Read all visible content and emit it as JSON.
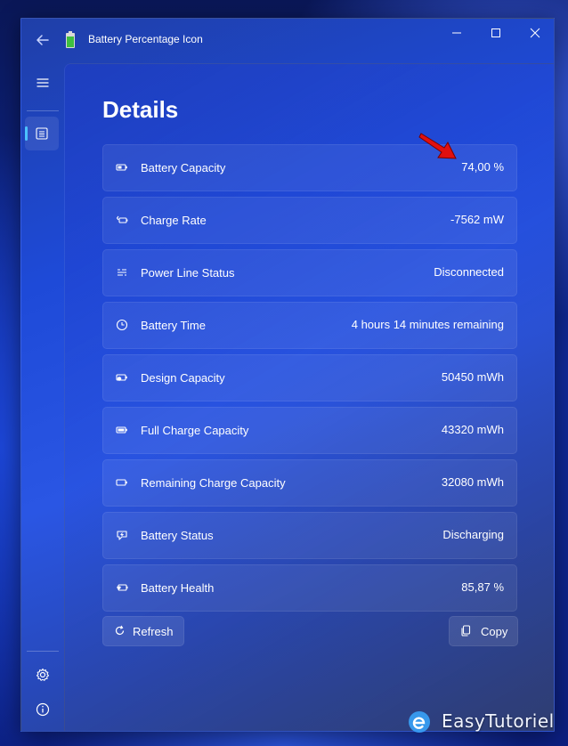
{
  "window": {
    "title": "Battery Percentage Icon"
  },
  "page": {
    "title": "Details"
  },
  "rows": [
    {
      "label": "Battery Capacity",
      "value": "74,00 %",
      "icon": "battery-icon"
    },
    {
      "label": "Charge Rate",
      "value": "-7562 mW",
      "icon": "charge-rate-icon"
    },
    {
      "label": "Power Line Status",
      "value": "Disconnected",
      "icon": "power-line-icon"
    },
    {
      "label": "Battery Time",
      "value": "4 hours 14 minutes remaining",
      "icon": "clock-icon"
    },
    {
      "label": "Design Capacity",
      "value": "50450 mWh",
      "icon": "design-capacity-icon"
    },
    {
      "label": "Full Charge Capacity",
      "value": "43320 mWh",
      "icon": "battery-full-icon"
    },
    {
      "label": "Remaining Charge Capacity",
      "value": "32080 mWh",
      "icon": "battery-empty-icon"
    },
    {
      "label": "Battery Status",
      "value": "Discharging",
      "icon": "battery-status-icon"
    },
    {
      "label": "Battery Health",
      "value": "85,87 %",
      "icon": "battery-health-icon"
    }
  ],
  "actions": {
    "refresh_label": "Refresh",
    "copy_label": "Copy"
  },
  "watermark": {
    "text": "EasyTutoriel"
  },
  "colors": {
    "accent": "#4cc2ff",
    "annotation_arrow": "#e01010"
  }
}
